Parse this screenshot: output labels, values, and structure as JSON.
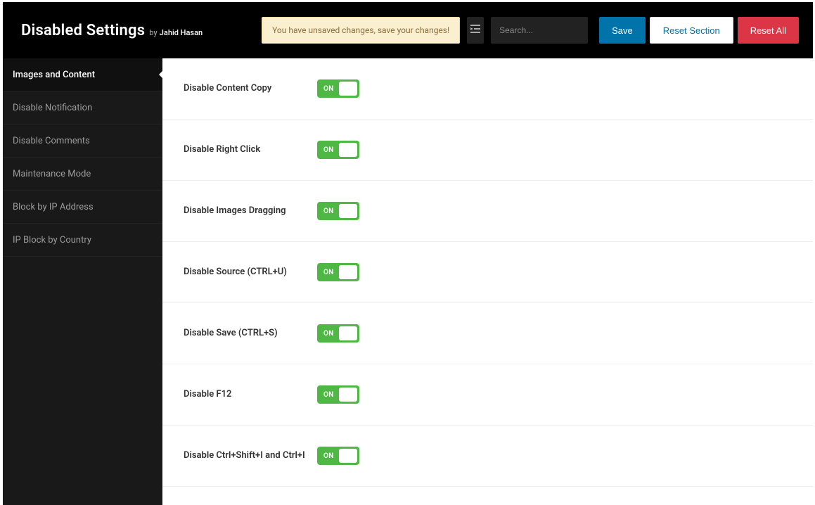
{
  "header": {
    "title": "Disabled Settings",
    "by_prefix": "by",
    "author": "Jahid Hasan",
    "unsaved_message": "You have unsaved changes, save your changes!",
    "search_placeholder": "Search...",
    "save_label": "Save",
    "reset_section_label": "Reset Section",
    "reset_all_label": "Reset All"
  },
  "sidebar": {
    "items": [
      {
        "label": "Images and Content",
        "active": true
      },
      {
        "label": "Disable Notification",
        "active": false
      },
      {
        "label": "Disable Comments",
        "active": false
      },
      {
        "label": "Maintenance Mode",
        "active": false
      },
      {
        "label": "Block by IP Address",
        "active": false
      },
      {
        "label": "IP Block by Country",
        "active": false
      }
    ]
  },
  "settings": {
    "toggle_on_label": "ON",
    "rows": [
      {
        "label": "Disable Content Copy",
        "value": true
      },
      {
        "label": "Disable Right Click",
        "value": true
      },
      {
        "label": "Disable Images Dragging",
        "value": true
      },
      {
        "label": "Disable Source (CTRL+U)",
        "value": true
      },
      {
        "label": "Disable Save (CTRL+S)",
        "value": true
      },
      {
        "label": "Disable F12",
        "value": true
      },
      {
        "label": "Disable Ctrl+Shift+I and Ctrl+I",
        "value": true
      }
    ]
  },
  "colors": {
    "toggle_on": "#4fb845",
    "save": "#0073aa",
    "reset_all": "#dc3545",
    "banner_bg": "#faefcf"
  }
}
